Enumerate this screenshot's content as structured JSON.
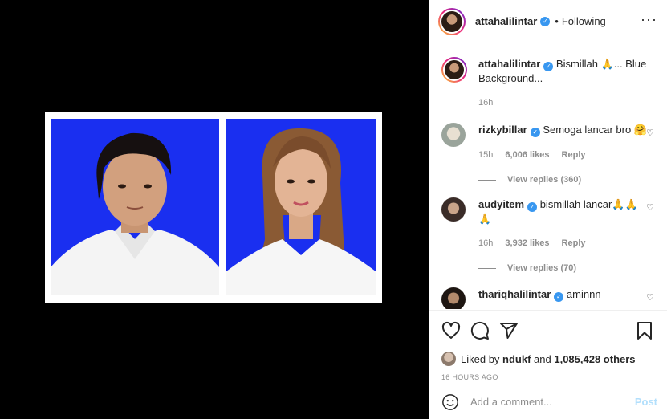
{
  "post": {
    "author": "attahalilintar",
    "follow_status": "Following",
    "separator": "•",
    "more_glyph": "···",
    "caption": "Bismillah 🙏... Blue Background...",
    "caption_time": "16h"
  },
  "comments": [
    {
      "user": "rizkybillar",
      "verified": true,
      "text": "Semoga lancar bro 🤗",
      "time": "15h",
      "likes": "6,006 likes",
      "reply_label": "Reply",
      "view_replies": "View replies (360)"
    },
    {
      "user": "audyitem",
      "verified": true,
      "text": "bismillah lancar🙏🙏🙏",
      "time": "16h",
      "likes": "3,932 likes",
      "reply_label": "Reply",
      "view_replies": "View replies (70)"
    },
    {
      "user": "thariqhalilintar",
      "verified": true,
      "text": "aminnn"
    }
  ],
  "likes_bar": {
    "liked_by_prefix": "Liked by ",
    "liked_by_user": "ndukf",
    "and_text": " and ",
    "others": "1,085,428 others"
  },
  "timestamp": "16 HOURS AGO",
  "composer": {
    "placeholder": "Add a comment...",
    "post_label": "Post"
  },
  "colors": {
    "photo_background": "#1a2ff0",
    "verified": "#3897f0",
    "post_disabled": "#b2dffc"
  },
  "icons": {
    "verified": "check-badge-icon",
    "like": "heart-icon",
    "comment": "comment-bubble-icon",
    "share": "paper-plane-icon",
    "save": "bookmark-icon",
    "emoji": "smiley-icon",
    "more": "more-options-icon"
  }
}
